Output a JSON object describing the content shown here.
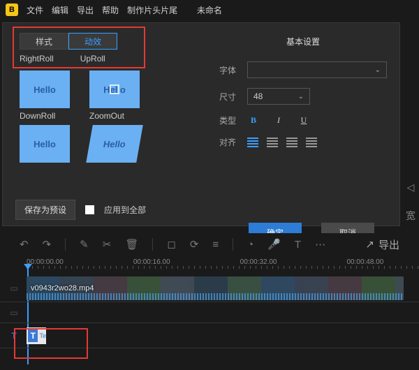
{
  "app": {
    "logo_letter": "B",
    "title": "未命名"
  },
  "menu": [
    "文件",
    "编辑",
    "导出",
    "帮助",
    "制作片头片尾"
  ],
  "tabs": {
    "style": "样式",
    "effects": "动效"
  },
  "effect_names": {
    "right_roll": "RightRoll",
    "up_roll": "UpRoll",
    "down_roll": "DownRoll",
    "zoom_out": "ZoomOut"
  },
  "effect_sample_text": "Hello",
  "panel_bottom": {
    "save_preset": "保存为预设",
    "apply_all": "应用到全部"
  },
  "settings": {
    "heading": "基本设置",
    "font_label": "字体",
    "size_label": "尺寸",
    "size_value": "48",
    "type_label": "类型",
    "align_label": "对齐",
    "ok": "确定",
    "cancel": "取消"
  },
  "sidebar": {
    "play": "◁",
    "width": "宽"
  },
  "toolbar": {
    "undo": "↶",
    "redo": "↷",
    "cut": "✂",
    "trash": "🗑",
    "clock": "◔",
    "mic": "🎤",
    "text": "T",
    "export_label": "导出",
    "export_icon": "↗"
  },
  "ruler": [
    "00:00:00.00",
    "00:00:16.00",
    "00:00:32.00",
    "00:00:48.00"
  ],
  "clip": {
    "video_name": "v0943r2wo28.mp4",
    "text_icon": "T",
    "text_lbl": "Te"
  }
}
